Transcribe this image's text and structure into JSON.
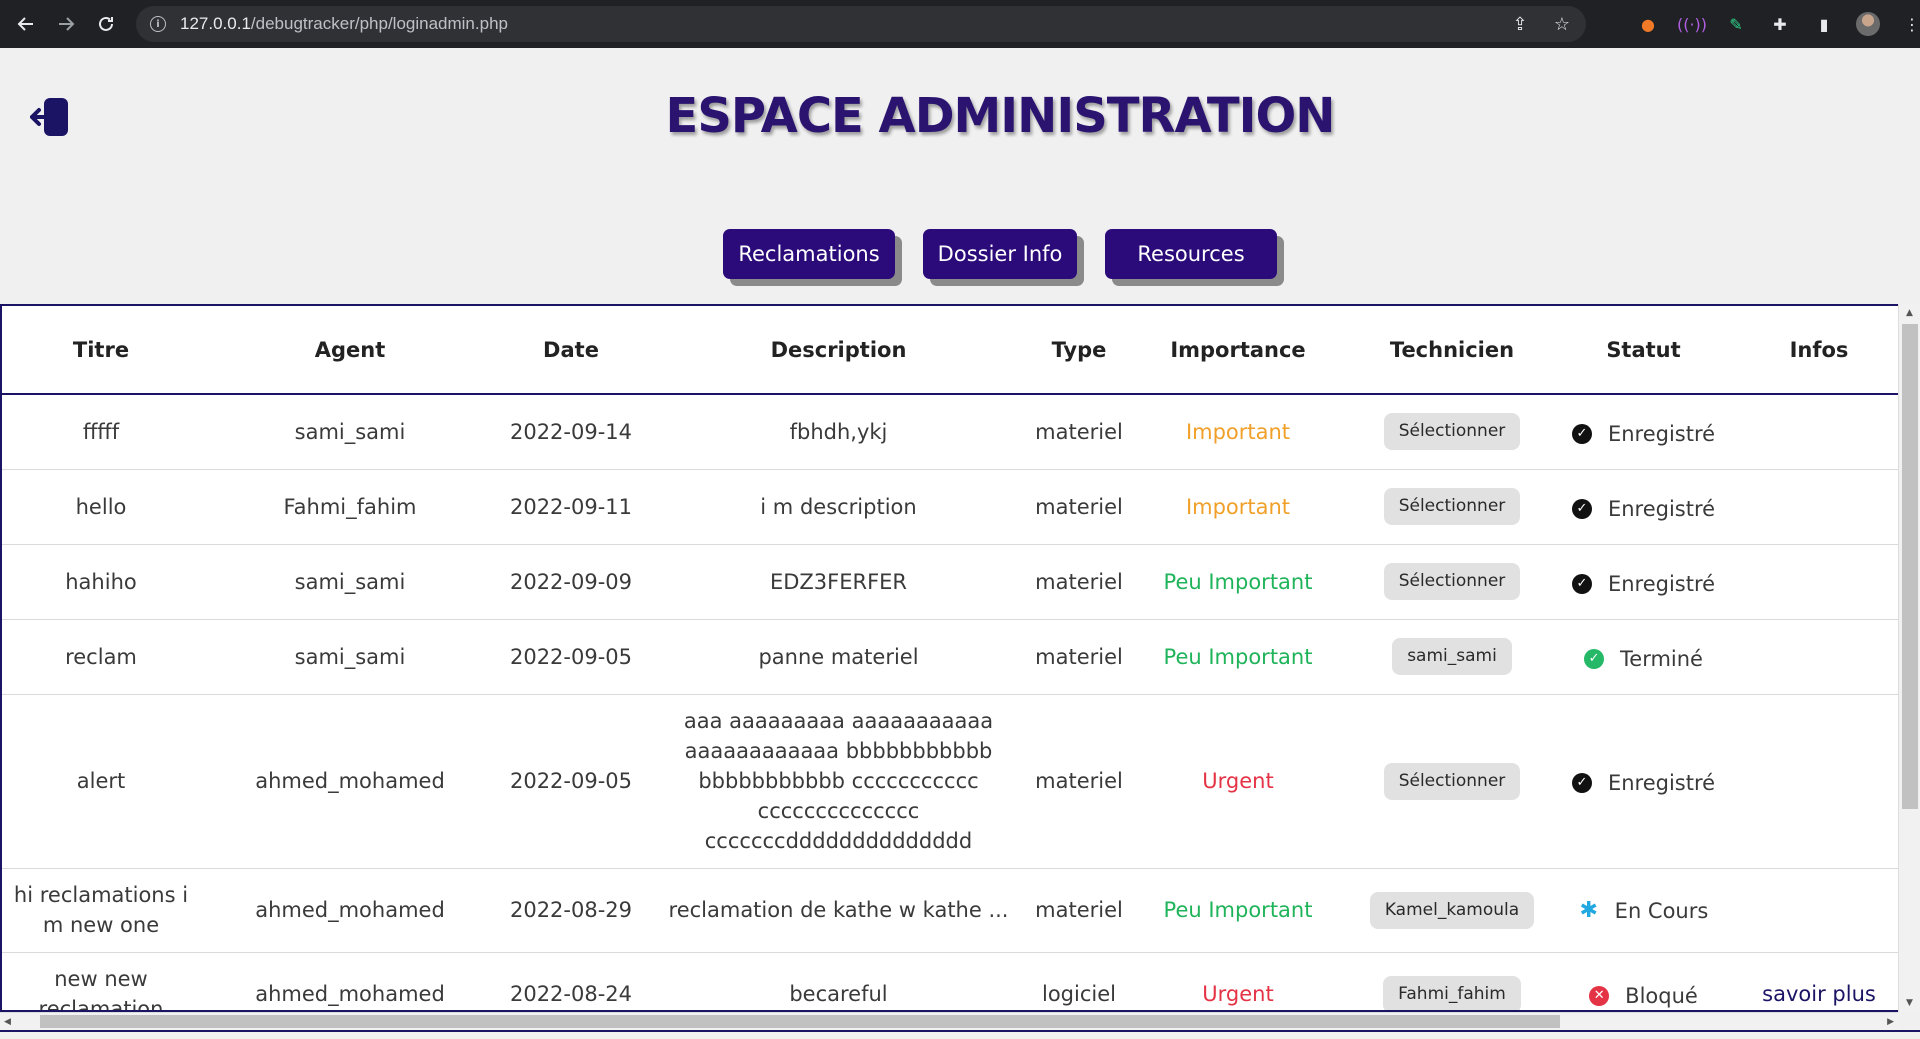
{
  "browser": {
    "url_host": "127.0.0.1",
    "url_path": "/debugtracker/php/loginadmin.php"
  },
  "page": {
    "title": "ESPACE ADMINISTRATION"
  },
  "nav": {
    "reclamations": "Reclamations",
    "dossier": "Dossier Info",
    "resources": "Resources"
  },
  "table": {
    "headers": [
      "Titre",
      "Agent",
      "Date",
      "Description",
      "Type",
      "Importance",
      "Technicien",
      "Statut",
      "Infos"
    ],
    "rows": [
      {
        "titre": "fffff",
        "agent": "sami_sami",
        "date": "2022-09-14",
        "description": "fbhdh,ykj",
        "type": "materiel",
        "importance": "Important",
        "technicien": "Sélectionner",
        "statut": "Enregistré",
        "infos": ""
      },
      {
        "titre": "hello",
        "agent": "Fahmi_fahim",
        "date": "2022-09-11",
        "description": "i m description",
        "type": "materiel",
        "importance": "Important",
        "technicien": "Sélectionner",
        "statut": "Enregistré",
        "infos": ""
      },
      {
        "titre": "hahiho",
        "agent": "sami_sami",
        "date": "2022-09-09",
        "description": "EDZ3FERFER",
        "type": "materiel",
        "importance": "Peu Important",
        "technicien": "Sélectionner",
        "statut": "Enregistré",
        "infos": ""
      },
      {
        "titre": "reclam",
        "agent": "sami_sami",
        "date": "2022-09-05",
        "description": "panne materiel",
        "type": "materiel",
        "importance": "Peu Important",
        "technicien": "sami_sami",
        "statut": "Terminé",
        "infos": ""
      },
      {
        "titre": "alert",
        "agent": "ahmed_mohamed",
        "date": "2022-09-05",
        "description": "aaa aaaaaaaaa aaaaaaaaaaa aaaaaaaaaaaa bbbbbbbbbbb bbbbbbbbbbb ccccccccccc cccccccccccccc cccccccdddddddddddddd",
        "type": "materiel",
        "importance": "Urgent",
        "technicien": "Sélectionner",
        "statut": "Enregistré",
        "infos": ""
      },
      {
        "titre": "hi reclamations i m new one",
        "agent": "ahmed_mohamed",
        "date": "2022-08-29",
        "description": "reclamation de kathe w kathe ...",
        "type": "materiel",
        "importance": "Peu Important",
        "technicien": "Kamel_kamoula",
        "statut": "En Cours",
        "infos": ""
      },
      {
        "titre": "new new reclamation",
        "agent": "ahmed_mohamed",
        "date": "2022-08-24",
        "description": "becareful",
        "type": "logiciel",
        "importance": "Urgent",
        "technicien": "Fahmi_fahim",
        "statut": "Bloqué",
        "infos": "savoir plus"
      }
    ]
  }
}
